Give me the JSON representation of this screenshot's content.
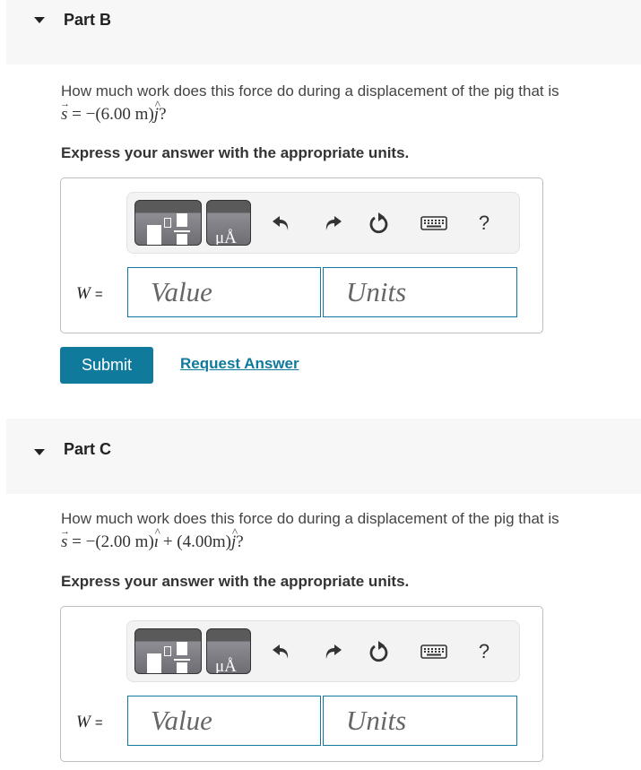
{
  "parts": [
    {
      "title": "Part B",
      "question_text": "How much work does this force do during a displacement of the pig that is",
      "equation": {
        "lhs": "s",
        "equals": "=",
        "terms": [
          "−(6.00 m)",
          "j",
          "?"
        ]
      },
      "instruction": "Express your answer with the appropriate units.",
      "variable": "W",
      "equals_sign": "=",
      "value_placeholder": "Value",
      "units_placeholder": "Units",
      "submit_label": "Submit",
      "request_answer_label": "Request Answer"
    },
    {
      "title": "Part C",
      "question_text": "How much work does this force do during a displacement of the pig that is",
      "equation": {
        "lhs": "s",
        "equals": "=",
        "terms": [
          "−(2.00 m)",
          "ı",
          "+ (4.00m)",
          "j",
          "?"
        ]
      },
      "instruction": "Express your answer with the appropriate units.",
      "variable": "W",
      "equals_sign": "=",
      "value_placeholder": "Value",
      "units_placeholder": "Units"
    }
  ],
  "toolbar": {
    "templates_icon": "templates-icon",
    "units_icon": "units-icon",
    "units_glyph": "μÅ",
    "undo_icon": "undo-icon",
    "redo_icon": "redo-icon",
    "reset_icon": "reset-icon",
    "keyboard_icon": "keyboard-icon",
    "help_label": "?"
  },
  "colors": {
    "accent": "#0f7a9c",
    "header_bg": "#f7f7f7",
    "toolbar_bg": "#f3f3f3"
  }
}
